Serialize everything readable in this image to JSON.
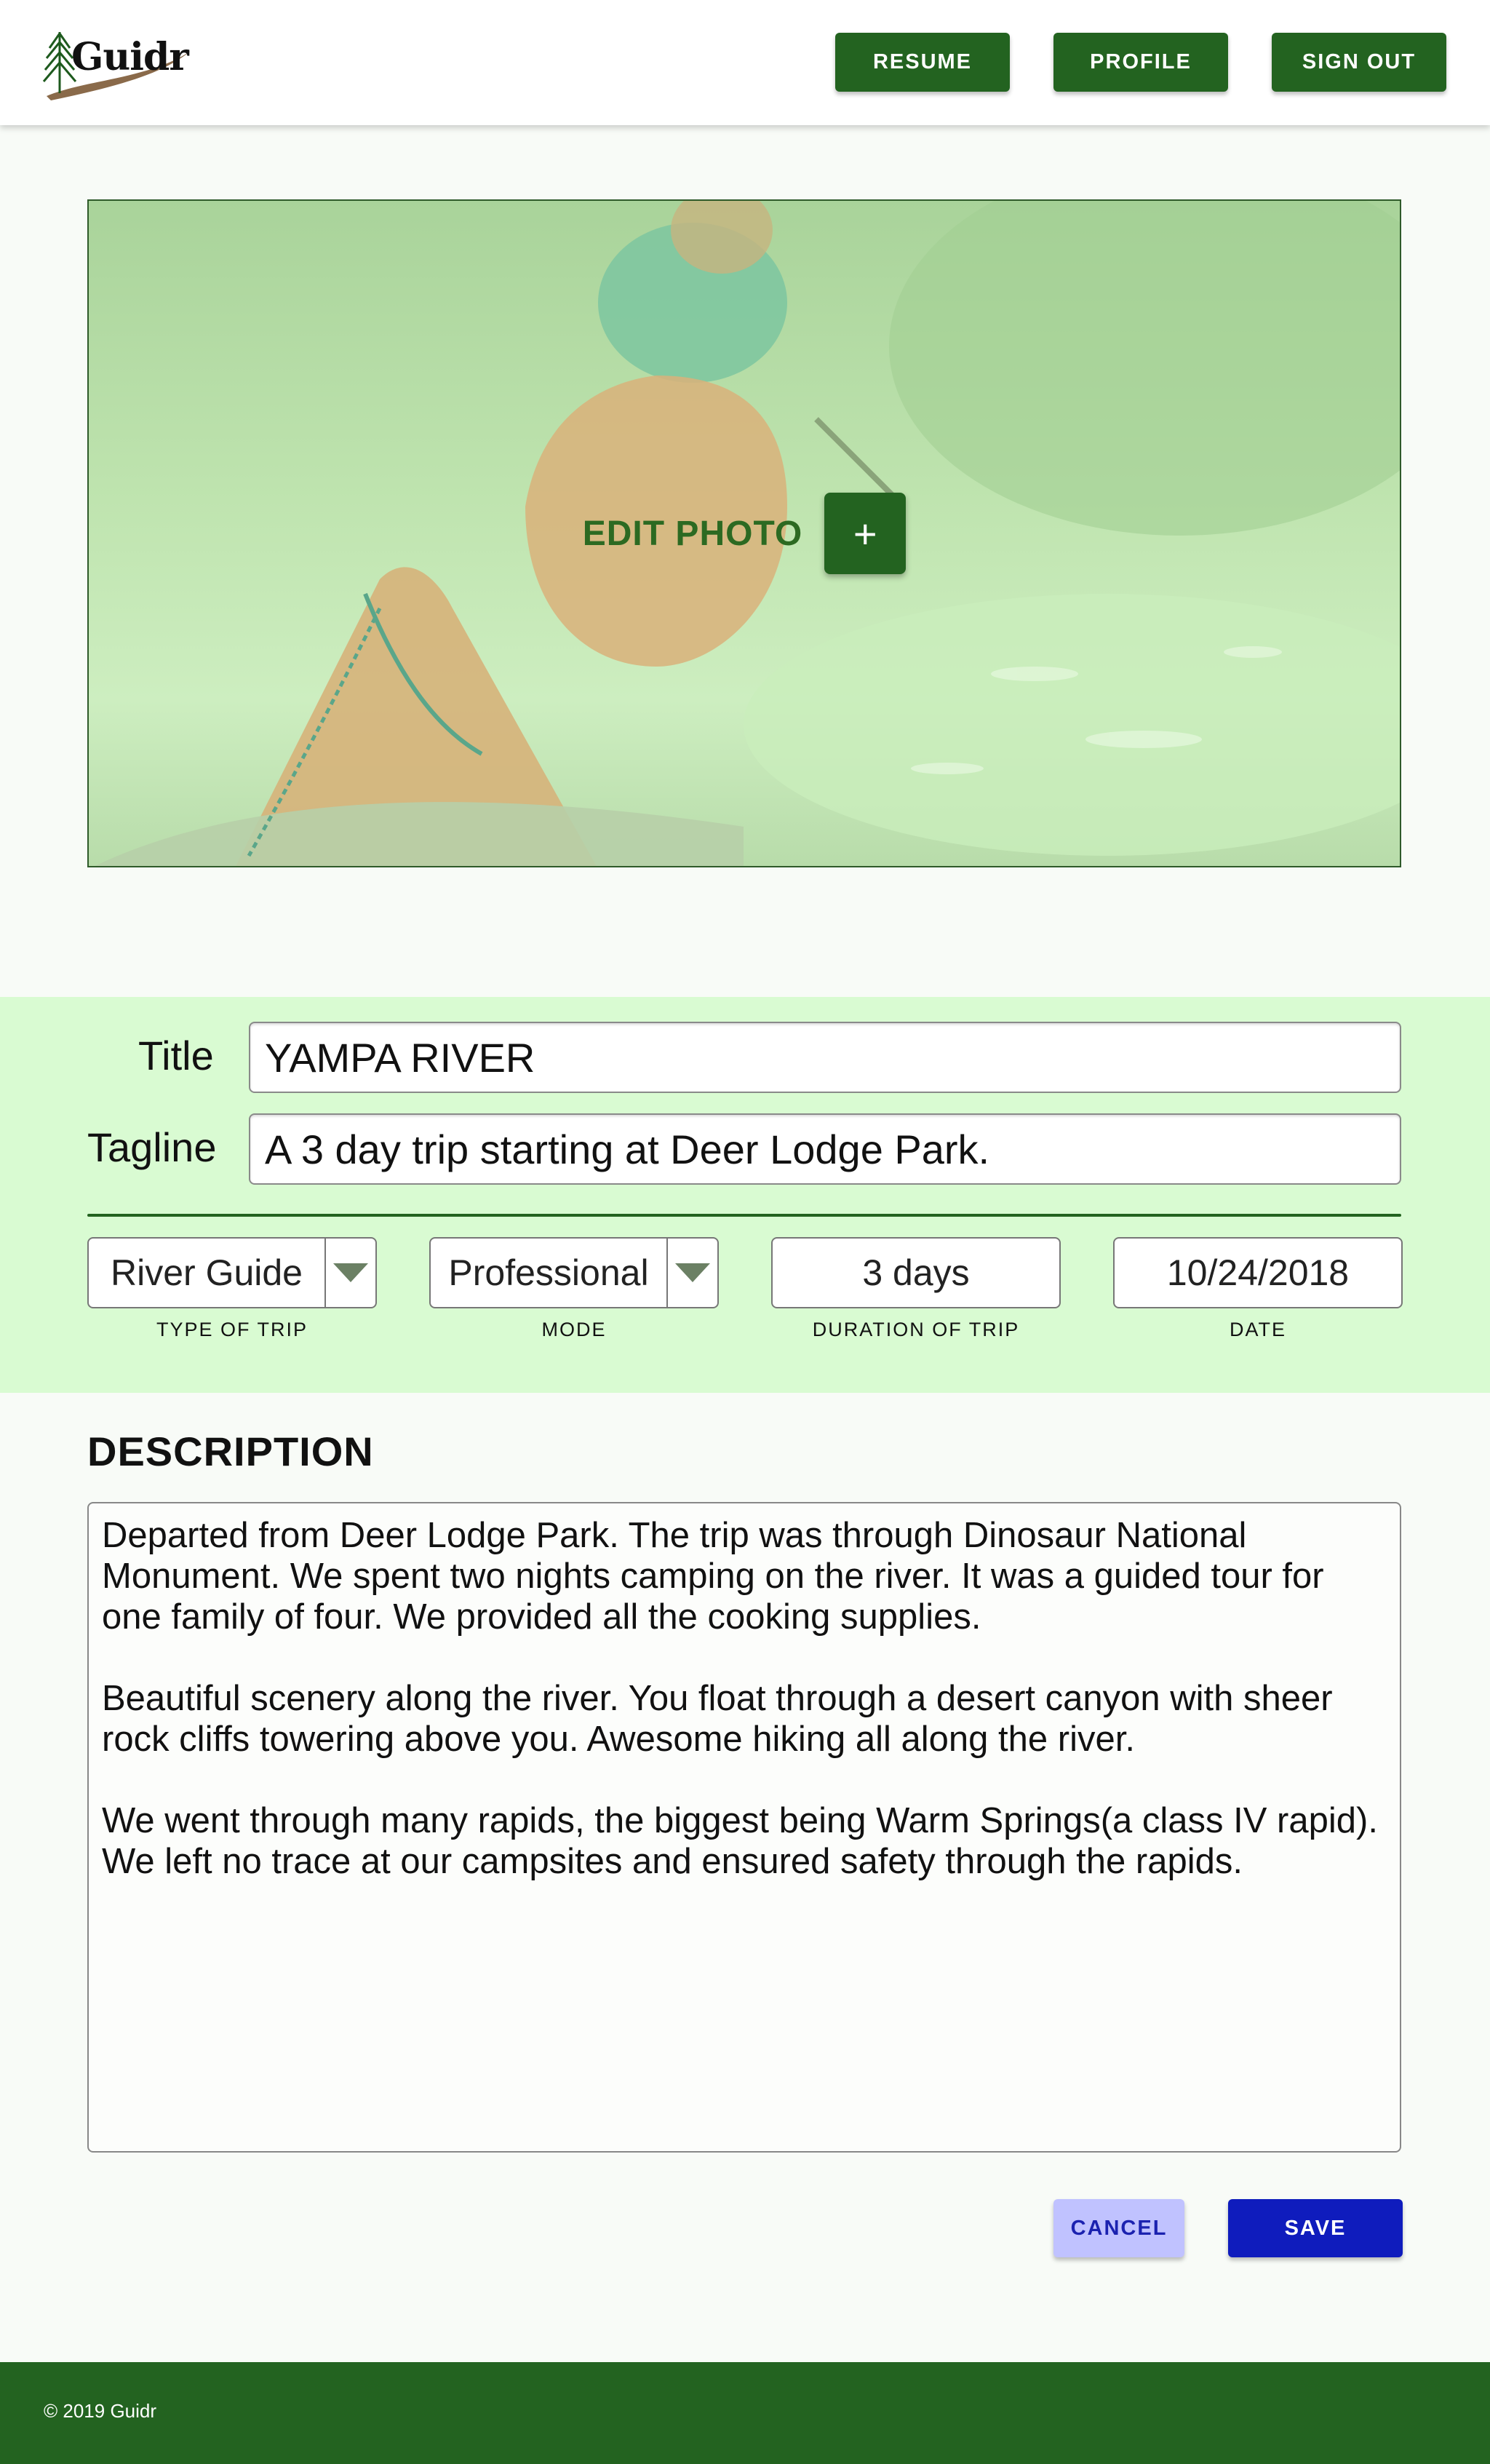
{
  "brand": {
    "name": "Guidr"
  },
  "nav": {
    "resume_label": "RESUME",
    "profile_label": "PROFILE",
    "signout_label": "SIGN OUT"
  },
  "photo": {
    "edit_label": "EDIT PHOTO",
    "add_symbol": "+"
  },
  "form": {
    "title_label": "Title",
    "title_value": "YAMPA RIVER",
    "tagline_label": "Tagline",
    "tagline_value": "A 3 day trip starting at Deer Lodge Park.",
    "type_of_trip": {
      "value": "River Guide",
      "caption": "TYPE OF TRIP"
    },
    "mode": {
      "value": "Professional",
      "caption": "MODE"
    },
    "duration": {
      "value": "3 days",
      "caption": "DURATION OF TRIP"
    },
    "date": {
      "value": "10/24/2018",
      "caption": "DATE"
    }
  },
  "description": {
    "heading": "DESCRIPTION",
    "paragraphs": [
      "Departed from Deer Lodge Park. The trip was through Dinosaur National Monument. We spent two nights camping on the river. It was a guided tour for one family of four. We provided all the cooking supplies.",
      "Beautiful scenery along the river. You float through a desert canyon with sheer rock cliffs towering above you. Awesome hiking all along the river.",
      "We went through many rapids, the biggest being Warm Springs(a class IV rapid). We left no trace at our campsites and ensured safety through the rapids."
    ]
  },
  "actions": {
    "cancel_label": "CANCEL",
    "save_label": "SAVE"
  },
  "footer": {
    "copyright": "© 2019 Guidr"
  },
  "colors": {
    "brand_green": "#236320",
    "band_green": "#d9fbd2",
    "save_blue": "#0f1cbd",
    "cancel_blue": "#c0c2ff"
  },
  "icons": {
    "logo": "pine-tree-logo-icon",
    "dropdown": "caret-down-icon",
    "add": "plus-icon"
  }
}
